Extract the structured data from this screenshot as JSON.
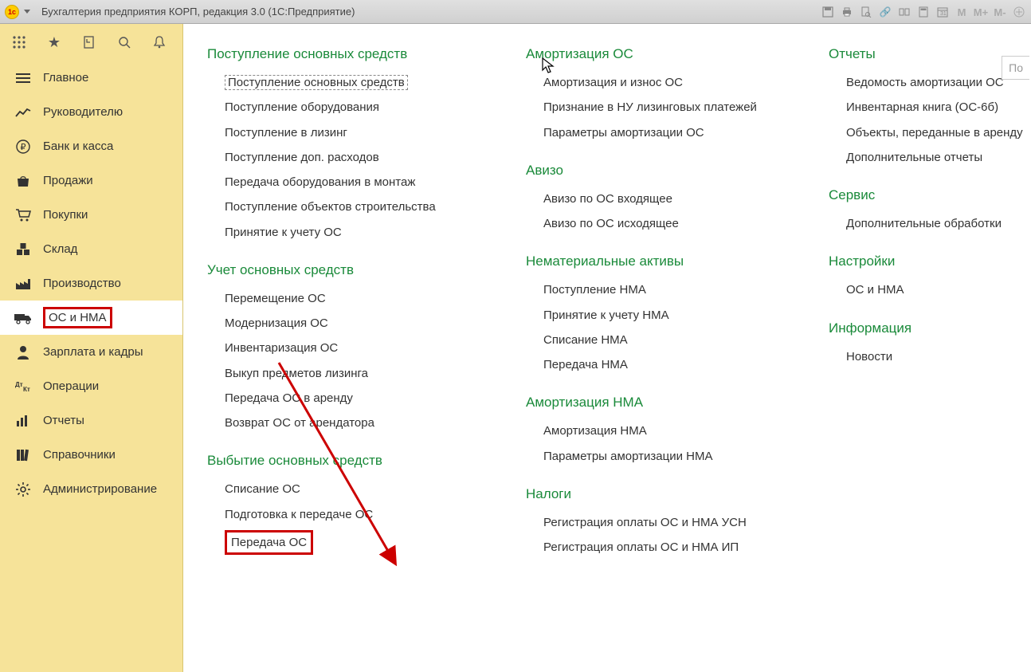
{
  "titlebar": {
    "title": "Бухгалтерия предприятия КОРП, редакция 3.0  (1С:Предприятие)",
    "m1": "M",
    "m2": "M+",
    "m3": "M-"
  },
  "search": {
    "placeholder": "По"
  },
  "sidebar": {
    "items": [
      {
        "label": "Главное"
      },
      {
        "label": "Руководителю"
      },
      {
        "label": "Банк и касса"
      },
      {
        "label": "Продажи"
      },
      {
        "label": "Покупки"
      },
      {
        "label": "Склад"
      },
      {
        "label": "Производство"
      },
      {
        "label": "ОС и НМА"
      },
      {
        "label": "Зарплата и кадры"
      },
      {
        "label": "Операции"
      },
      {
        "label": "Отчеты"
      },
      {
        "label": "Справочники"
      },
      {
        "label": "Администрирование"
      }
    ]
  },
  "content": {
    "col1": [
      {
        "title": "Поступление основных средств",
        "items": [
          "Поступление основных средств",
          "Поступление оборудования",
          "Поступление в лизинг",
          "Поступление доп. расходов",
          "Передача оборудования в монтаж",
          "Поступление объектов строительства",
          "Принятие к учету ОС"
        ]
      },
      {
        "title": "Учет основных средств",
        "items": [
          "Перемещение ОС",
          "Модернизация ОС",
          "Инвентаризация ОС",
          "Выкуп предметов лизинга",
          "Передача ОС в аренду",
          "Возврат ОС от арендатора"
        ]
      },
      {
        "title": "Выбытие основных средств",
        "items": [
          "Списание ОС",
          "Подготовка к передаче ОС",
          "Передача ОС"
        ]
      }
    ],
    "col2": [
      {
        "title": "Амортизация ОС",
        "items": [
          "Амортизация и износ ОС",
          "Признание в НУ лизинговых платежей",
          "Параметры амортизации ОС"
        ]
      },
      {
        "title": "Авизо",
        "items": [
          "Авизо по ОС входящее",
          "Авизо по ОС исходящее"
        ]
      },
      {
        "title": "Нематериальные активы",
        "items": [
          "Поступление НМА",
          "Принятие к учету НМА",
          "Списание НМА",
          "Передача НМА"
        ]
      },
      {
        "title": "Амортизация НМА",
        "items": [
          "Амортизация НМА",
          "Параметры амортизации НМА"
        ]
      },
      {
        "title": "Налоги",
        "items": [
          "Регистрация оплаты ОС и НМА УСН",
          "Регистрация оплаты ОС и НМА ИП"
        ]
      }
    ],
    "col3": [
      {
        "title": "Отчеты",
        "items": [
          "Ведомость амортизации ОС",
          "Инвентарная книга (ОС-6б)",
          "Объекты, переданные в аренду",
          "Дополнительные отчеты"
        ]
      },
      {
        "title": "Сервис",
        "items": [
          "Дополнительные обработки"
        ]
      },
      {
        "title": "Настройки",
        "items": [
          "ОС и НМА"
        ]
      },
      {
        "title": "Информация",
        "items": [
          "Новости"
        ]
      }
    ]
  }
}
